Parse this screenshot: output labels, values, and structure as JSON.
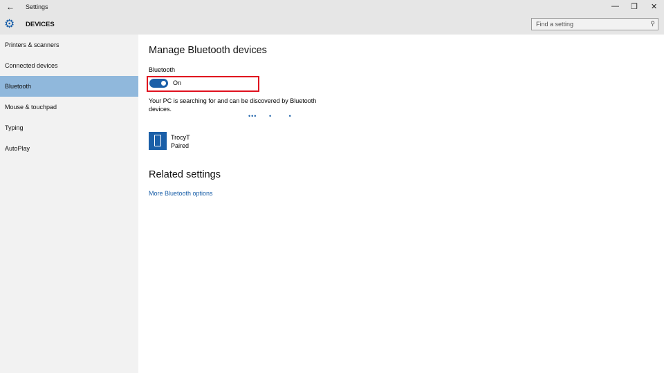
{
  "window": {
    "title": "Settings",
    "back": "←",
    "minimize": "—",
    "restore": "❐",
    "close": "✕"
  },
  "header": {
    "section": "DEVICES",
    "search_placeholder": "Find a setting"
  },
  "sidebar": {
    "items": [
      {
        "label": "Printers & scanners"
      },
      {
        "label": "Connected devices"
      },
      {
        "label": "Bluetooth",
        "selected": true
      },
      {
        "label": "Mouse & touchpad"
      },
      {
        "label": "Typing"
      },
      {
        "label": "AutoPlay"
      }
    ]
  },
  "main": {
    "title": "Manage Bluetooth devices",
    "bluetooth_label": "Bluetooth",
    "toggle_state": "On",
    "description": "Your PC is searching for and can be discovered by Bluetooth devices.",
    "progress_dots": "•••     •       •",
    "device": {
      "name": "TrocyT",
      "status": "Paired"
    },
    "related_title": "Related settings",
    "related_link": "More Bluetooth options"
  },
  "colors": {
    "accent": "#1a5fa8",
    "selected": "#90b8dc",
    "highlight": "#e0101e"
  }
}
